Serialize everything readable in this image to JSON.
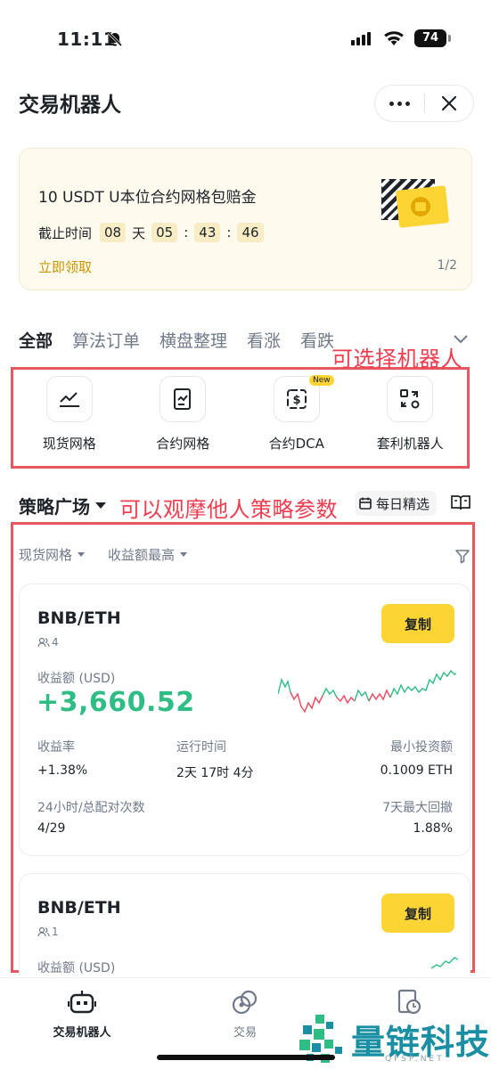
{
  "status_bar": {
    "time": "11:11",
    "battery": "74"
  },
  "header": {
    "title": "交易机器人"
  },
  "promo": {
    "title": "10 USDT U本位合约网格包赔金",
    "deadline_label": "截止时间",
    "days": "08",
    "day_unit": "天",
    "hours": "05",
    "minutes": "43",
    "seconds": "46",
    "sep": ":",
    "cta": "立即领取",
    "pager": "1/2"
  },
  "tabs": [
    {
      "label": "全部"
    },
    {
      "label": "算法订单"
    },
    {
      "label": "横盘整理"
    },
    {
      "label": "看涨"
    },
    {
      "label": "看跌"
    }
  ],
  "annotations": {
    "select_bot": "可选择机器人",
    "view_strategies": "可以观摩他人策略参数"
  },
  "bot_types": [
    {
      "label": "现货网格",
      "icon": "spot-grid-icon"
    },
    {
      "label": "合约网格",
      "icon": "futures-grid-icon"
    },
    {
      "label": "合约DCA",
      "icon": "futures-dca-icon",
      "badge": "New"
    },
    {
      "label": "套利机器人",
      "icon": "arbitrage-bot-icon"
    }
  ],
  "strategy_square": {
    "title": "策略广场",
    "daily_pick": "每日精选",
    "filters": [
      {
        "label": "现货网格"
      },
      {
        "label": "收益额最高"
      }
    ]
  },
  "cards": [
    {
      "pair": "BNB/ETH",
      "followers": "4",
      "copy": "复制",
      "pnl_label": "收益额 (USD)",
      "pnl_value": "+3,660.52",
      "roi_label": "收益率",
      "roi_value": "+1.38%",
      "runtime_label": "运行时间",
      "runtime_value": "2天 17时 4分",
      "min_inv_label": "最小投资额",
      "min_inv_value": "0.1009 ETH",
      "matches_label": "24小时/总配对次数",
      "matches_value": "4/29",
      "drawdown_label": "7天最大回撤",
      "drawdown_value": "1.88%"
    },
    {
      "pair": "BNB/ETH",
      "followers": "1",
      "copy": "复制",
      "pnl_label": "收益额 (USD)"
    }
  ],
  "bottom_nav": [
    {
      "label": "交易机器人",
      "icon": "robot-icon"
    },
    {
      "label": "交易",
      "icon": "trade-icon"
    },
    {
      "label": "",
      "icon": "history-icon"
    }
  ],
  "watermark": {
    "text": "量链科技",
    "sub": "QFSP.NET"
  },
  "colors": {
    "brand_yellow": "#fcd535",
    "profit_green": "#2ebd85",
    "loss_red": "#f6465d",
    "annotation_red": "#f23d4f"
  }
}
